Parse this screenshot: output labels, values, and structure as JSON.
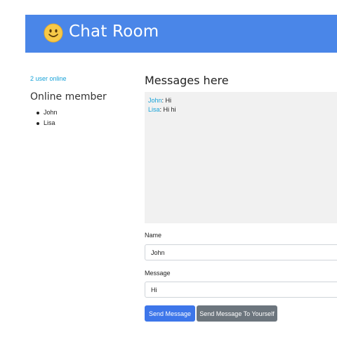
{
  "header": {
    "title": "Chat Room",
    "icon": "smiley-face-icon",
    "background": "#4a86e8"
  },
  "sidebar": {
    "online_count": "2 user online",
    "heading": "Online member",
    "members": [
      "John",
      "Lisa"
    ]
  },
  "main": {
    "heading": "Messages here",
    "messages": [
      {
        "sender": "John",
        "text": "Hi"
      },
      {
        "sender": "Lisa",
        "text": "Hi hi"
      }
    ]
  },
  "form": {
    "name_label": "Name",
    "name_value": "John",
    "message_label": "Message",
    "message_value": "Hi",
    "send_label": "Send Message",
    "send_self_label": "Send Message To Yourself"
  },
  "colors": {
    "accent": "#17a2d8",
    "send_button": "#3d76ea",
    "secondary_button": "#6c757d"
  }
}
